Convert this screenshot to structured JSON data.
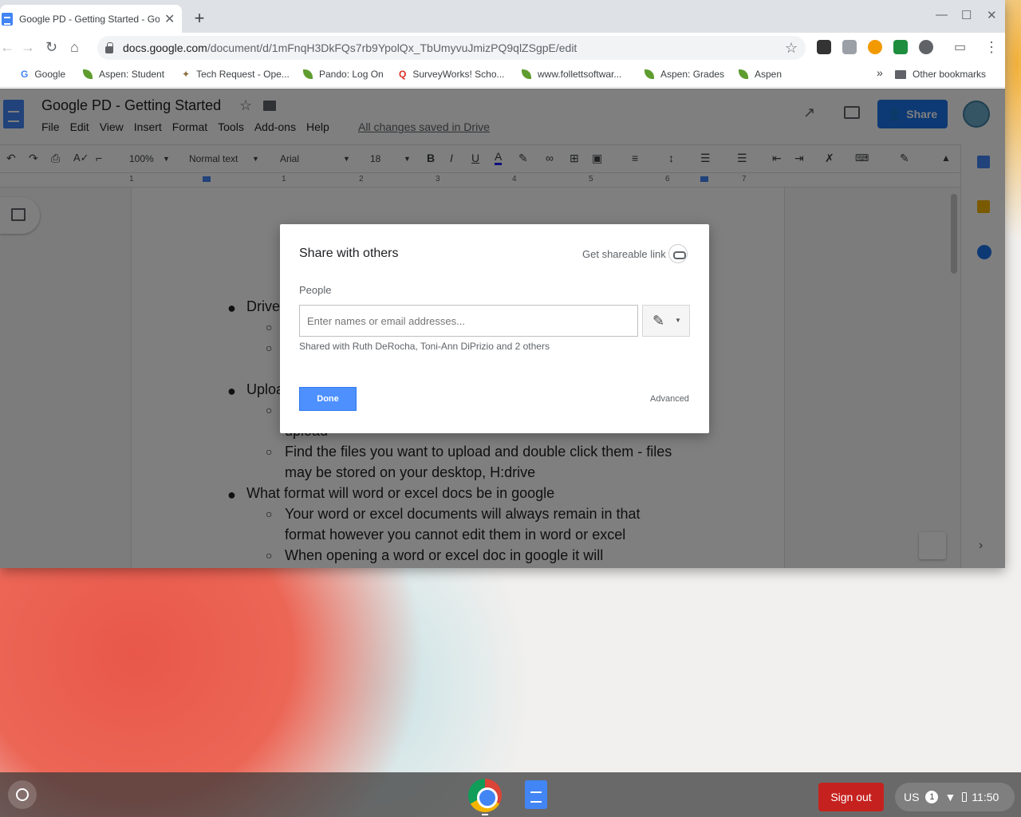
{
  "browser": {
    "tab_title": "Google PD - Getting Started - Google Docs",
    "url_domain": "docs.google.com",
    "url_path": "/document/d/1mFnqH3DkFQs7rb9YpolQx_TbUmyvuJmizPQ9qlZSgpE/edit",
    "bookmarks": [
      "Google",
      "Aspen: Student",
      "Tech Request - Ope...",
      "Pando: Log On",
      "SurveyWorks! Scho...",
      "www.follettsoftwar...",
      "Aspen: Grades",
      "Aspen"
    ],
    "other_bookmarks": "Other bookmarks",
    "more_bookmarks": "»"
  },
  "docs": {
    "title": "Google PD - Getting Started",
    "menus": [
      "File",
      "Edit",
      "View",
      "Insert",
      "Format",
      "Tools",
      "Add-ons",
      "Help"
    ],
    "saved_status": "All changes saved in Drive",
    "share_label": "Share",
    "toolbar": {
      "zoom": "100%",
      "style": "Normal text",
      "font": "Arial",
      "size": "18"
    },
    "ruler_numbers": [
      "1",
      "1",
      "2",
      "3",
      "4",
      "5",
      "6",
      "7"
    ],
    "lines": [
      {
        "bullet": "●",
        "text": "Drive"
      },
      {
        "bullet": "○",
        "text": ""
      },
      {
        "bullet": "○",
        "text": ""
      },
      {
        "bullet": "●",
        "text": "Uploa"
      },
      {
        "bullet": "○",
        "text": ""
      },
      {
        "bullet": "",
        "text": "upload"
      },
      {
        "bullet": "○",
        "text": "Find the files you want to upload and double click them - files"
      },
      {
        "bullet": "",
        "text": "may be stored on your desktop, H:drive"
      },
      {
        "bullet": "●",
        "text": "What format will word or excel docs be in google"
      },
      {
        "bullet": "○",
        "text": "Your word or excel documents will always remain in that"
      },
      {
        "bullet": "",
        "text": "format however you cannot edit them in word or excel"
      },
      {
        "bullet": "○",
        "text": "When opening a word or excel doc in google it will"
      }
    ]
  },
  "dialog": {
    "title": "Share with others",
    "shareable_link": "Get shareable link",
    "people_label": "People",
    "input_placeholder": "Enter names or email addresses...",
    "shared_with": "Shared with Ruth DeRocha, Toni-Ann DiPrizio and 2 others",
    "done_label": "Done",
    "advanced_label": "Advanced"
  },
  "shelf": {
    "sign_out": "Sign out",
    "ime": "US",
    "notifications": "1",
    "time": "11:50"
  }
}
